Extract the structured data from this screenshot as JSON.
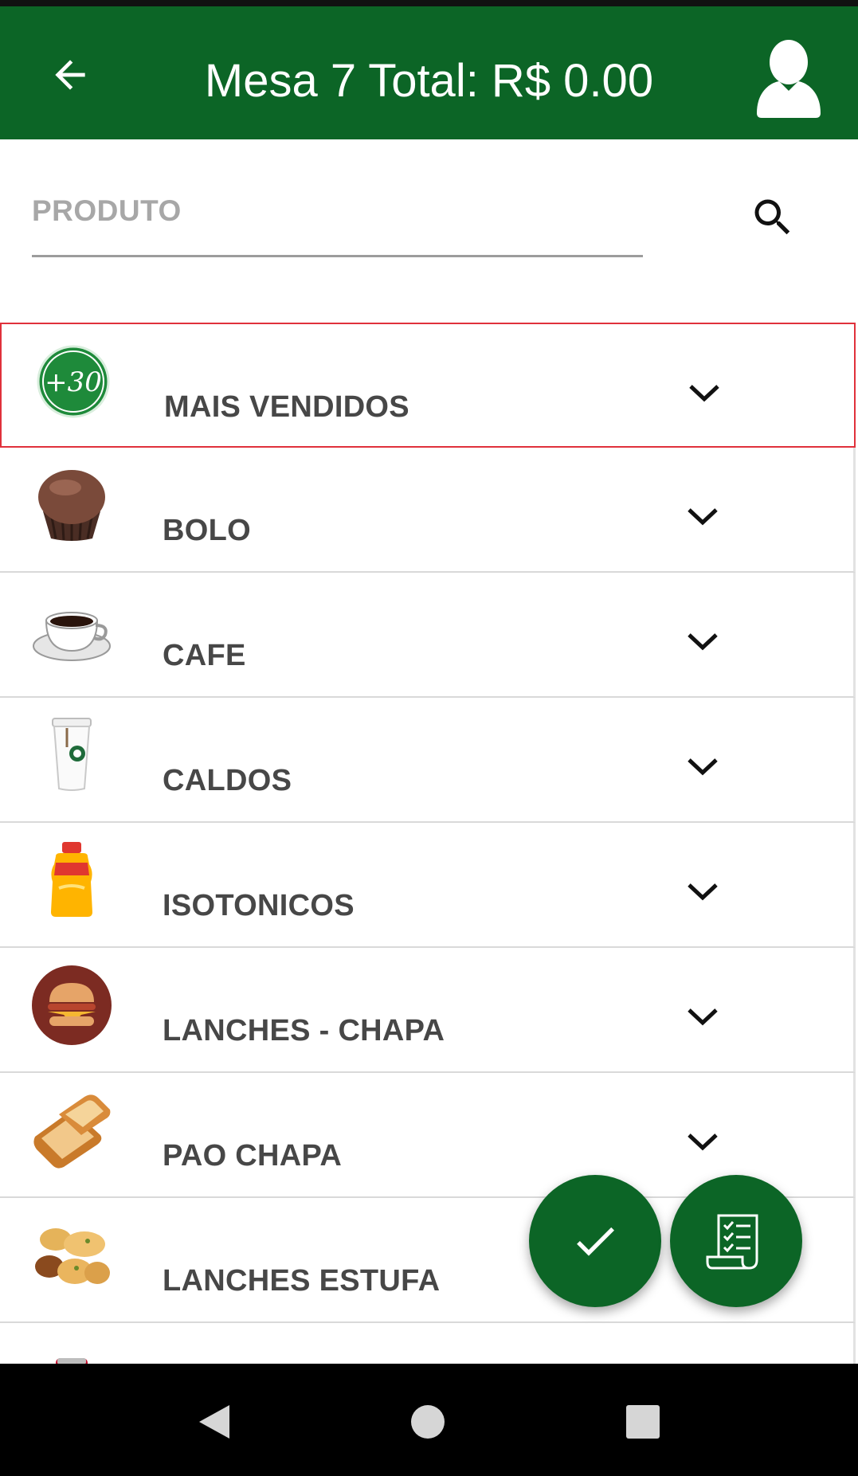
{
  "app_bar": {
    "title": "Mesa 7 Total: R$ 0.00",
    "back_icon": "arrow-left-icon",
    "user_icon": "user-profile-icon"
  },
  "search": {
    "placeholder": "PRODUTO",
    "value": "",
    "icon": "search-icon"
  },
  "categories": [
    {
      "label": "MAIS VENDIDOS",
      "icon": "plus-30-badge-icon",
      "selected": true
    },
    {
      "label": "BOLO",
      "icon": "muffin-icon",
      "selected": false
    },
    {
      "label": "CAFE",
      "icon": "coffee-cup-icon",
      "selected": false
    },
    {
      "label": "CALDOS",
      "icon": "paper-cup-icon",
      "selected": false
    },
    {
      "label": "ISOTONICOS",
      "icon": "sports-drink-bottle-icon",
      "selected": false
    },
    {
      "label": "LANCHES - CHAPA",
      "icon": "burger-icon",
      "selected": false
    },
    {
      "label": "PAO CHAPA",
      "icon": "toast-bread-icon",
      "selected": false
    },
    {
      "label": "LANCHES ESTUFA",
      "icon": "savory-snacks-icon",
      "selected": false
    }
  ],
  "fabs": {
    "confirm_icon": "checkmark-icon",
    "order_icon": "checklist-receipt-icon"
  },
  "system_nav": {
    "back_icon": "triangle-back-icon",
    "home_icon": "circle-home-icon",
    "recent_icon": "square-recents-icon"
  },
  "colors": {
    "primary": "#0c6526",
    "selected_border": "#e0313b",
    "label_text": "#474747"
  }
}
